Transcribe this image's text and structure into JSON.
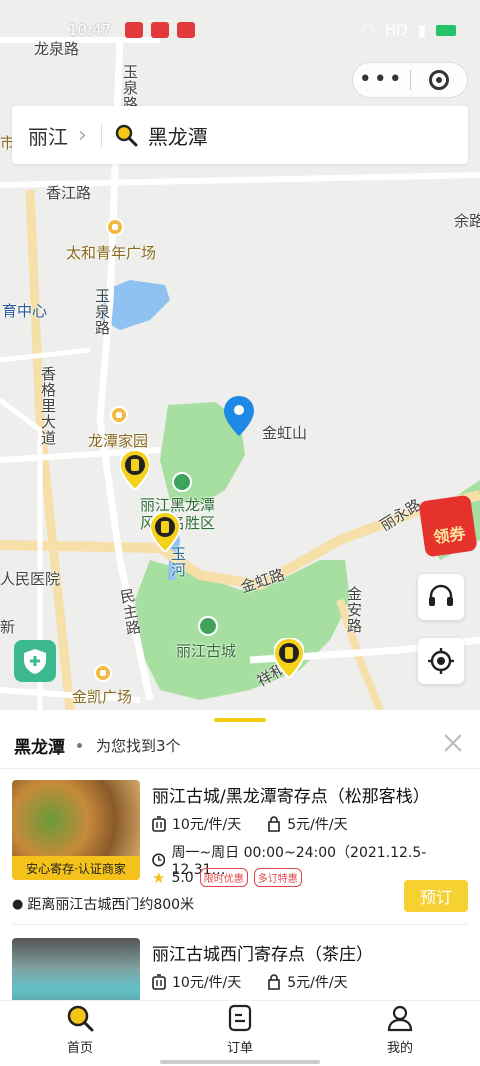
{
  "statusbar": {
    "time": "10:47",
    "right_text": "HD"
  },
  "search": {
    "city": "丽江",
    "query": "黑龙潭"
  },
  "map": {
    "labels": {
      "longquan_rd": "龙泉路",
      "yuquan_rd_top": "玉泉路",
      "xiangjiang_rd": "香江路",
      "taihe_plaza": "太和青年广场",
      "yuquan_rd_mid": "玉泉路",
      "sports_center": "育中心",
      "xiang_ge_li": "香格里大道",
      "longtan_garden": "龙潭家园",
      "jinhongshan": "金虹山",
      "heilongtan_scenic_1": "丽江黑龙潭",
      "heilongtan_scenic_2": "风景名胜区",
      "yuhe": "玉河",
      "liyong_rd": "丽永路",
      "jinhong_rd": "金虹路",
      "jinan_rd": "金安路",
      "people_hospital": "人民医院",
      "minzhu_rd": "民主路",
      "lijiang_oldtown": "丽江古城",
      "xiang_he": "祥和",
      "jinkai_plaza": "金凯广场",
      "yu_lu": "余路",
      "shi_fu": "市",
      "xin_rd": "新"
    },
    "coupon_label": "领券"
  },
  "sheet": {
    "title": "黑龙潭",
    "subtitle": "为您找到3个",
    "stores": [
      {
        "name": "丽江古城/黑龙潭寄存点（松那客栈）",
        "price_large": "10元/件/天",
        "price_small": "5元/件/天",
        "hours": "周一~周日 00:00~24:00（2021.12.5-12.31…",
        "rating": "5.0",
        "tags": [
          "限时优惠",
          "多订特惠"
        ],
        "caption": "安心寄存·认证商家",
        "distance": "距离丽江古城西门约800米",
        "book": "预订"
      },
      {
        "name": "丽江古城西门寄存点（茶庄）",
        "price_large": "10元/件/天",
        "price_small": "5元/件/天"
      }
    ]
  },
  "tabs": [
    {
      "label": "首页",
      "icon": "search-icon"
    },
    {
      "label": "订单",
      "icon": "order-icon"
    },
    {
      "label": "我的",
      "icon": "profile-icon"
    }
  ],
  "colors": {
    "accent": "#F5D132",
    "pin_blue": "#1E88E5",
    "park_green": "#A6DFA0"
  }
}
